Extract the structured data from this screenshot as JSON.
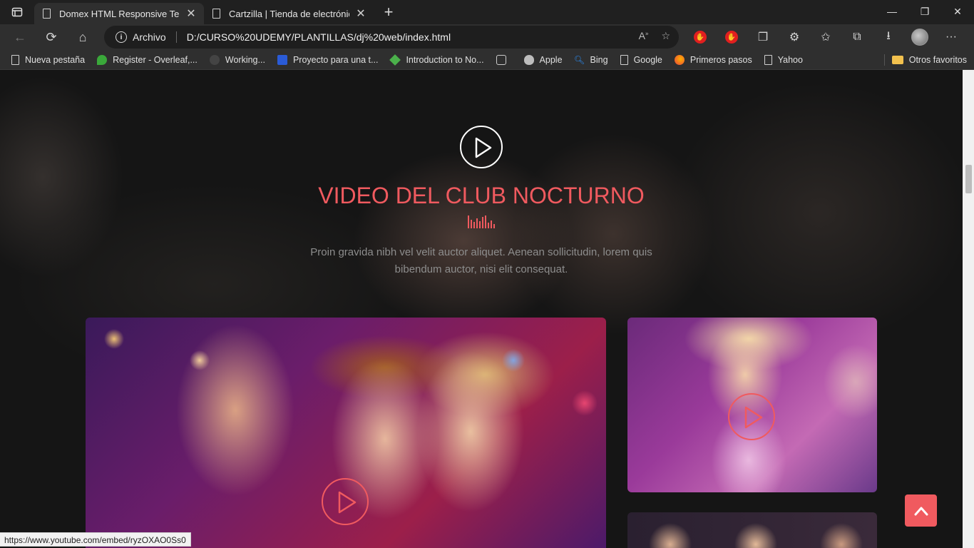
{
  "browser": {
    "tabs": [
      {
        "title": "Domex HTML Responsive Templa",
        "active": true
      },
      {
        "title": "Cartzilla | Tienda de electrónica",
        "active": false
      }
    ],
    "address": {
      "scheme_label": "Archivo",
      "url": "D:/CURSO%20UDEMY/PLANTILLAS/dj%20web/index.html"
    },
    "bookmarks": [
      {
        "label": "Nueva pestaña",
        "icon": "page-icon"
      },
      {
        "label": "Register - Overleaf,...",
        "icon": "overleaf-icon"
      },
      {
        "label": "Working...",
        "icon": "github-icon"
      },
      {
        "label": "Proyecto para una t...",
        "icon": "site-icon"
      },
      {
        "label": "Introduction to No...",
        "icon": "node-icon"
      },
      {
        "label": "",
        "icon": "box-icon"
      },
      {
        "label": "Apple",
        "icon": "apple-icon"
      },
      {
        "label": "Bing",
        "icon": "bing-icon"
      },
      {
        "label": "Google",
        "icon": "page-icon"
      },
      {
        "label": "Primeros pasos",
        "icon": "firefox-icon"
      },
      {
        "label": "Yahoo",
        "icon": "page-icon"
      }
    ],
    "other_favorites": "Otros favoritos",
    "status_url": "https://www.youtube.com/embed/ryzOXAO0Ss0"
  },
  "page": {
    "heading": "VIDEO DEL CLUB NOCTURNO",
    "description": "Proin gravida nibh vel velit auctor aliquet. Aenean sollicitudin, lorem quis bibendum auctor, nisi elit consequat.",
    "accent_color": "#f05a5f"
  }
}
